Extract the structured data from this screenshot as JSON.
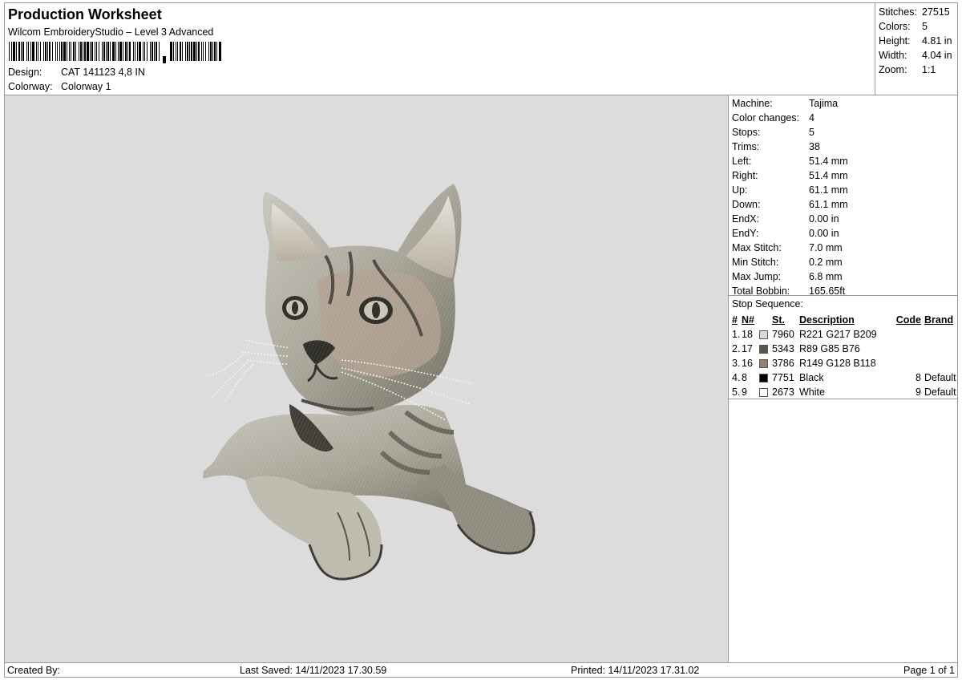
{
  "header": {
    "title": "Production Worksheet",
    "subtitle": "Wilcom EmbroideryStudio – Level 3 Advanced",
    "design_label": "Design:",
    "design_value": "CAT 141123 4,8 IN",
    "colorway_label": "Colorway:",
    "colorway_value": "Colorway 1"
  },
  "stats": [
    {
      "label": "Stitches:",
      "value": "27515"
    },
    {
      "label": "Colors:",
      "value": "5"
    },
    {
      "label": "Height:",
      "value": "4.81 in"
    },
    {
      "label": "Width:",
      "value": "4.04 in"
    },
    {
      "label": "Zoom:",
      "value": "1:1"
    }
  ],
  "machine": [
    {
      "label": "Machine:",
      "value": "Tajima"
    },
    {
      "label": "Color changes:",
      "value": "4"
    },
    {
      "label": "Stops:",
      "value": "5"
    },
    {
      "label": "Trims:",
      "value": "38"
    },
    {
      "label": "Left:",
      "value": "51.4 mm"
    },
    {
      "label": "Right:",
      "value": "51.4 mm"
    },
    {
      "label": "Up:",
      "value": "61.1 mm"
    },
    {
      "label": "Down:",
      "value": "61.1 mm"
    },
    {
      "label": "EndX:",
      "value": "0.00 in"
    },
    {
      "label": "EndY:",
      "value": "0.00 in"
    },
    {
      "label": "Max Stitch:",
      "value": "7.0 mm"
    },
    {
      "label": "Min Stitch:",
      "value": "0.2 mm"
    },
    {
      "label": "Max Jump:",
      "value": "6.8 mm"
    },
    {
      "label": "Total Bobbin:",
      "value": "165.65ft"
    }
  ],
  "stop_sequence": {
    "title": "Stop Sequence:",
    "headers": {
      "idx": "#",
      "n": "N#",
      "st": "St.",
      "desc": "Description",
      "code": "Code",
      "brand": "Brand"
    },
    "rows": [
      {
        "idx": "1.",
        "n": "18",
        "color": "#ddd9d1",
        "st": "7960",
        "desc": "R221 G217 B209",
        "code": "",
        "brand": ""
      },
      {
        "idx": "2.",
        "n": "17",
        "color": "#59554c",
        "st": "5343",
        "desc": "R89 G85 B76",
        "code": "",
        "brand": ""
      },
      {
        "idx": "3.",
        "n": "16",
        "color": "#958076",
        "st": "3786",
        "desc": "R149 G128 B118",
        "code": "",
        "brand": ""
      },
      {
        "idx": "4.",
        "n": "8",
        "color": "#000000",
        "st": "7751",
        "desc": "Black",
        "code": "8",
        "brand": "Default"
      },
      {
        "idx": "5.",
        "n": "9",
        "color": "#ffffff",
        "st": "2673",
        "desc": "White",
        "code": "9",
        "brand": "Default"
      }
    ]
  },
  "footer": {
    "created_by": "Created By:",
    "last_saved": "Last Saved: 14/11/2023 17.30.59",
    "printed": "Printed: 14/11/2023 17.31.02",
    "page": "Page 1 of 1"
  },
  "colors": {
    "preview_bg": "#dcdcdc",
    "border": "#9a9a9a"
  }
}
